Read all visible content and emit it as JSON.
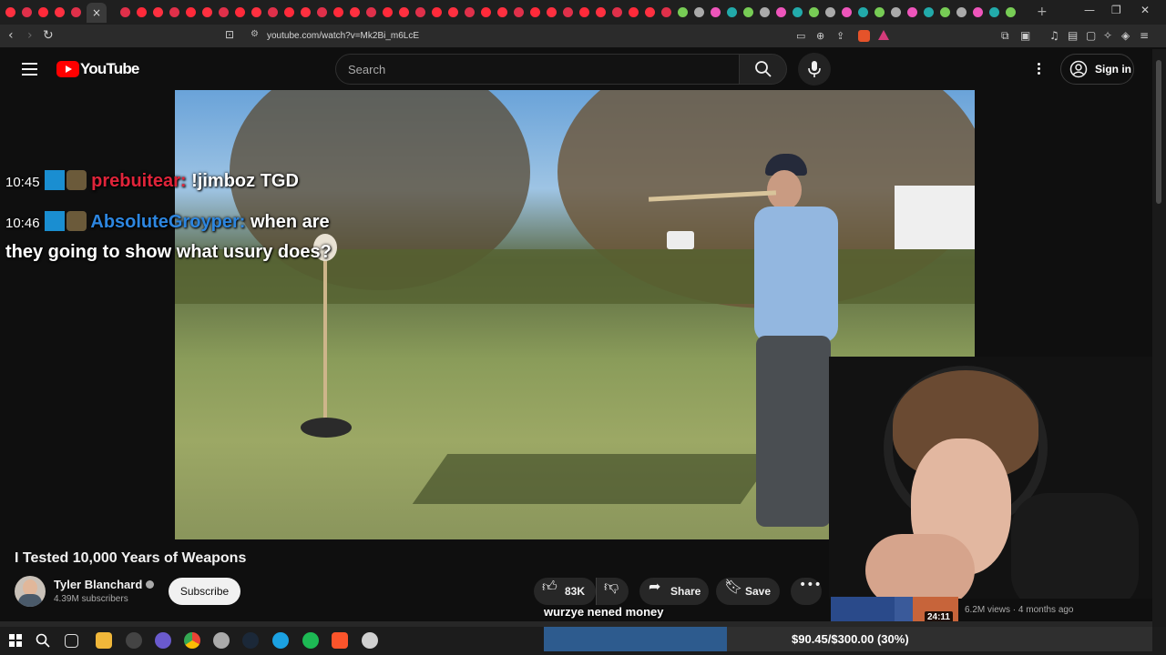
{
  "browser": {
    "url": "youtube.com/watch?v=Mk2Bi_m6LcE",
    "new_tab": "+",
    "close_tab": "×"
  },
  "youtube": {
    "logo_text": "YouTube",
    "search_placeholder": "Search",
    "sign_in": "Sign in"
  },
  "chat": [
    {
      "time": "10:45",
      "user": "prebuitear",
      "user_color": "#e0243a",
      "message": "!jimboz TGD"
    },
    {
      "time": "10:46",
      "user": "AbsoluteGroyper",
      "user_color": "#2d86e0",
      "message": "when are",
      "message_cont": "they going to show what usury does?"
    }
  ],
  "video": {
    "title": "I Tested 10,000 Years of Weapons",
    "channel": "Tyler Blanchard",
    "subscribers": "4.39M subscribers",
    "subscribe_label": "Subscribe",
    "likes": "83K",
    "share_label": "Share",
    "save_label": "Save"
  },
  "recommended": {
    "duration": "24:11",
    "meta": "6.2M views · 4 months ago"
  },
  "overlay": {
    "donation_text": "wurzye nened money",
    "goal_text": "$90.45/$300.00 (30%)",
    "goal_fraction": 0.3015
  },
  "colors": {
    "accent": "#ff0000",
    "link": "#3ea6ff",
    "goal_fill": "#2d5b8e"
  }
}
